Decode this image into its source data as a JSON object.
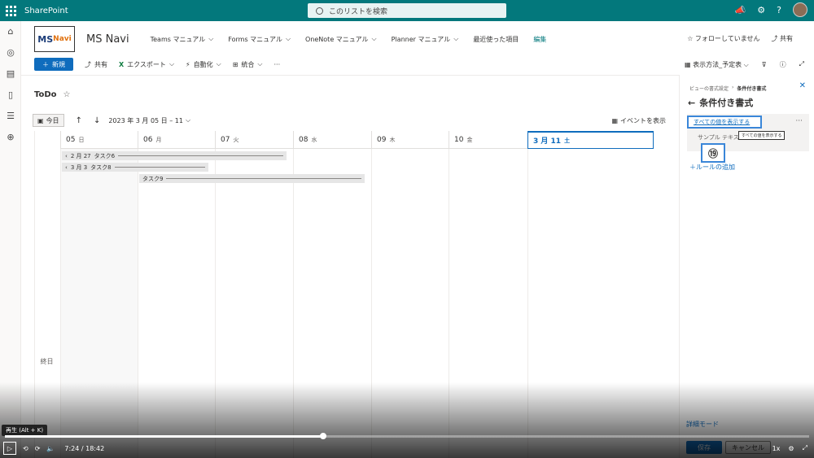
{
  "suite": {
    "app_name": "SharePoint",
    "search_placeholder": "このリストを検索"
  },
  "site": {
    "logo_main": "MS",
    "logo_sub": "Navi",
    "title": "MS Navi",
    "nav": [
      {
        "label": "Teams マニュアル",
        "chevron": "⌵"
      },
      {
        "label": "Forms マニュアル",
        "chevron": "⌵"
      },
      {
        "label": "OneNote マニュアル",
        "chevron": "⌵"
      },
      {
        "label": "Planner マニュアル",
        "chevron": "⌵"
      },
      {
        "label": "最近使った項目",
        "chevron": ""
      }
    ],
    "edit_label": "編集",
    "follow_label": "☆ フォローしていません",
    "share_label": "共有"
  },
  "commands": {
    "new_label": "新規",
    "share_label": "共有",
    "export_label": "エクスポート",
    "automate_label": "自動化",
    "integrate_label": "統合",
    "more_label": "···",
    "view_label": "表示方法_予定表"
  },
  "list": {
    "title": "ToDo",
    "today_label": "今日",
    "date_range": "2023 年 3 月 05 日 – 11",
    "show_events_label": "イベントを表示",
    "allday_label": "終日",
    "days": [
      {
        "num": "05",
        "dow": "日",
        "current": false,
        "weekend": true
      },
      {
        "num": "06",
        "dow": "月",
        "current": false,
        "weekend": false
      },
      {
        "num": "07",
        "dow": "火",
        "current": false,
        "weekend": false
      },
      {
        "num": "08",
        "dow": "水",
        "current": false,
        "weekend": false
      },
      {
        "num": "09",
        "dow": "木",
        "current": false,
        "weekend": false
      },
      {
        "num": "10",
        "dow": "金",
        "current": false,
        "weekend": false
      },
      {
        "num": "3 月 11",
        "dow": "土",
        "current": true,
        "weekend": true
      }
    ],
    "events": [
      {
        "date_label": "2 月 27",
        "name": "タスク6",
        "start_col": 0,
        "span": 3,
        "row": 0,
        "continued": true
      },
      {
        "date_label": "3 月 3",
        "name": "タスク8",
        "start_col": 0,
        "span": 2,
        "row": 1,
        "continued": true
      },
      {
        "date_label": "",
        "name": "タスク9",
        "start_col": 1,
        "span": 3,
        "row": 2,
        "continued": false
      }
    ]
  },
  "panel": {
    "breadcrumb_parent": "ビューの書式設定",
    "breadcrumb_current": "条件付き書式",
    "title": "条件付き書式",
    "rule_link": "すべての値を表示する",
    "rule_more": "···",
    "rule_sample": "サンプル テキスト",
    "tooltip": "すべての値を表示する",
    "badge": "⑲",
    "add_rule": "＋ルールの追加",
    "detail_mode": "詳細モード",
    "save_label": "保存",
    "cancel_label": "キャンセル"
  },
  "video": {
    "play_tooltip": "再生 (Alt + K)",
    "time": "7:24 / 18:42",
    "speed": "1x",
    "progress_fraction": 0.396
  }
}
